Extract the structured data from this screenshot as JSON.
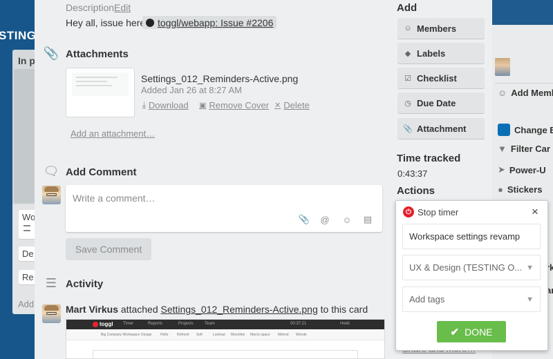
{
  "board": {
    "title": "STING",
    "list_title": "In p",
    "cards": [
      "Wo",
      "De",
      "Re"
    ],
    "add_card": "Add"
  },
  "right_menu": {
    "add_members": "Add Memb",
    "change_bg": "Change B",
    "filter_cards": "Filter Car",
    "power_ups": "Power-U",
    "stickers": "Stickers",
    "scrap_1": "rk",
    "scrap_2": "ar"
  },
  "card": {
    "description": {
      "label": "Description",
      "edit": "Edit",
      "text": "Hey all, issue here:",
      "link": "toggl/webapp: Issue #2206"
    },
    "attachments": {
      "title": "Attachments",
      "items": [
        {
          "name": "Settings_012_Reminders-Active.png",
          "added": "Added Jan 26 at 8:27 AM",
          "download": "Download",
          "remove_cover": "Remove Cover",
          "delete": "Delete"
        }
      ],
      "add": "Add an attachment…"
    },
    "comment": {
      "title": "Add Comment",
      "placeholder": "Write a comment…",
      "save": "Save Comment"
    },
    "activity": {
      "title": "Activity",
      "entries": [
        {
          "user": "Mart Virkus",
          "verb": "attached",
          "file": "Settings_012_Reminders-Active.png",
          "suffix": "to this card"
        }
      ],
      "preview": {
        "logo": "toggl",
        "nav": [
          "Timer",
          "Reports",
          "Projects",
          "Team"
        ],
        "timer": "00:37:21",
        "user": "Heidi",
        "subnav": [
          "Big Company Workspace",
          "Design",
          "Hello",
          "Refresh",
          "Soft",
          "Lookout",
          "Moonline",
          "Macro space",
          "Metrod",
          "Wonde"
        ]
      }
    }
  },
  "sidebar": {
    "add_heading": "Add",
    "buttons": {
      "members": "Members",
      "labels": "Labels",
      "checklist": "Checklist",
      "due_date": "Due Date",
      "attachment": "Attachment"
    },
    "time_tracked_heading": "Time tracked",
    "time_tracked_value": "0:43:37",
    "actions_heading": "Actions",
    "share_more": "Share and more…"
  },
  "toggl_popup": {
    "stop_timer": "Stop timer",
    "close": "×",
    "description": "Workspace settings revamp",
    "project": "UX & Design (TESTING O...",
    "tags": "Add tags",
    "done": "DONE",
    "done_color": "#69bd4a",
    "stop_color": "#e2202a"
  }
}
